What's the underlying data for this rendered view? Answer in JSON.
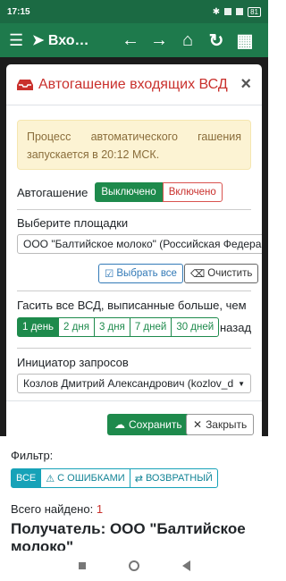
{
  "statusbar": {
    "time": "17:15",
    "battery": "81"
  },
  "appbar": {
    "title": "Вхо…"
  },
  "modal": {
    "title": "Автогашение входящих ВСД",
    "close": "×",
    "alert_text": "Процесс автоматического гашения запускается в 20:12 МСК.",
    "auto_label": "Автогашение",
    "toggle": {
      "off": "Выключено",
      "on": "Включено"
    },
    "sites_label": "Выберите площадки",
    "site_value": "ООО \"Балтийское молоко\" (Российская Федерация",
    "select_all": "Выбрать все",
    "clear": "Очистить",
    "days_label": "Гасить все ВСД, выписанные больше, чем",
    "days": [
      "1 день",
      "2 дня",
      "3 дня",
      "7 дней",
      "30 дней"
    ],
    "days_suffix": "назад",
    "initiator_label": "Инициатор запросов",
    "initiator_value": "Козлов Дмитрий Александрович (kozlov_d",
    "save": "Сохранить",
    "close_btn": "Закрыть"
  },
  "page": {
    "filter_label": "Фильтр:",
    "filters": [
      "ВСЕ",
      "С ОШИБКАМИ",
      "ВОЗВРАТНЫЙ"
    ],
    "total_label": "Всего найдено:",
    "total_count": "1",
    "recipient": "Получатель: ООО \"Балтийское молоко\""
  },
  "colors": {
    "primary": "#1e8a4c",
    "danger": "#c9302c",
    "info": "#17a2b8",
    "warning_bg": "#fcf3d3"
  }
}
